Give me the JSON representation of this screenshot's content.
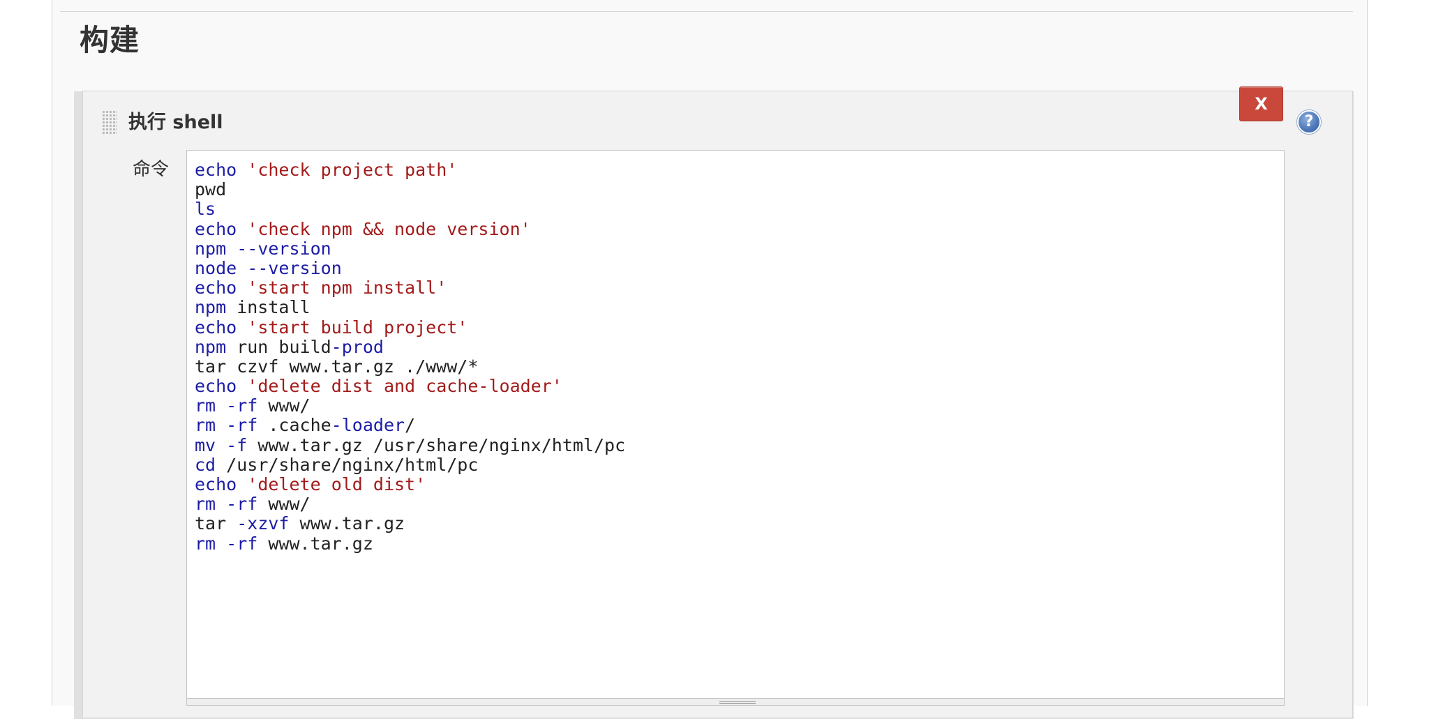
{
  "section": {
    "title": "构建"
  },
  "build_step": {
    "title": "执行 shell",
    "delete_label": "X",
    "help_label": "?",
    "command_label": "命令"
  },
  "command": {
    "lines": [
      [
        {
          "t": "echo",
          "c": "kw"
        },
        {
          "t": " ",
          "c": "plain"
        },
        {
          "t": "'check project path'",
          "c": "str"
        }
      ],
      [
        {
          "t": "pwd",
          "c": "plain"
        }
      ],
      [
        {
          "t": "ls",
          "c": "kw"
        }
      ],
      [
        {
          "t": "echo",
          "c": "kw"
        },
        {
          "t": " ",
          "c": "plain"
        },
        {
          "t": "'check npm && node version'",
          "c": "str"
        }
      ],
      [
        {
          "t": "npm",
          "c": "kw"
        },
        {
          "t": " ",
          "c": "plain"
        },
        {
          "t": "--version",
          "c": "kw"
        }
      ],
      [
        {
          "t": "node",
          "c": "kw"
        },
        {
          "t": " ",
          "c": "plain"
        },
        {
          "t": "--version",
          "c": "kw"
        }
      ],
      [
        {
          "t": "echo",
          "c": "kw"
        },
        {
          "t": " ",
          "c": "plain"
        },
        {
          "t": "'start npm install'",
          "c": "str"
        }
      ],
      [
        {
          "t": "npm",
          "c": "kw"
        },
        {
          "t": " install",
          "c": "plain"
        }
      ],
      [
        {
          "t": "echo",
          "c": "kw"
        },
        {
          "t": " ",
          "c": "plain"
        },
        {
          "t": "'start build project'",
          "c": "str"
        }
      ],
      [
        {
          "t": "npm",
          "c": "kw"
        },
        {
          "t": " run build",
          "c": "plain"
        },
        {
          "t": "-prod",
          "c": "kw"
        }
      ],
      [
        {
          "t": "tar czvf www.tar.gz ./www/*",
          "c": "plain"
        }
      ],
      [
        {
          "t": "echo",
          "c": "kw"
        },
        {
          "t": " ",
          "c": "plain"
        },
        {
          "t": "'delete dist and cache-loader'",
          "c": "str"
        }
      ],
      [
        {
          "t": "rm",
          "c": "kw"
        },
        {
          "t": " ",
          "c": "plain"
        },
        {
          "t": "-rf",
          "c": "kw"
        },
        {
          "t": " www/",
          "c": "plain"
        }
      ],
      [
        {
          "t": "rm",
          "c": "kw"
        },
        {
          "t": " ",
          "c": "plain"
        },
        {
          "t": "-rf",
          "c": "kw"
        },
        {
          "t": " .cache",
          "c": "plain"
        },
        {
          "t": "-loader",
          "c": "kw"
        },
        {
          "t": "/",
          "c": "plain"
        }
      ],
      [
        {
          "t": "mv",
          "c": "kw"
        },
        {
          "t": " ",
          "c": "plain"
        },
        {
          "t": "-f",
          "c": "kw"
        },
        {
          "t": " www.tar.gz /usr/share/nginx/html/pc",
          "c": "plain"
        }
      ],
      [
        {
          "t": "cd",
          "c": "kw"
        },
        {
          "t": " /usr/share/nginx/html/pc",
          "c": "plain"
        }
      ],
      [
        {
          "t": "echo",
          "c": "kw"
        },
        {
          "t": " ",
          "c": "plain"
        },
        {
          "t": "'delete old dist'",
          "c": "str"
        }
      ],
      [
        {
          "t": "rm",
          "c": "kw"
        },
        {
          "t": " ",
          "c": "plain"
        },
        {
          "t": "-rf",
          "c": "kw"
        },
        {
          "t": " www/",
          "c": "plain"
        }
      ],
      [
        {
          "t": "tar",
          "c": "plain"
        },
        {
          "t": " ",
          "c": "plain"
        },
        {
          "t": "-xzvf",
          "c": "kw"
        },
        {
          "t": " www.tar.gz",
          "c": "plain"
        }
      ],
      [
        {
          "t": "rm",
          "c": "kw"
        },
        {
          "t": " ",
          "c": "plain"
        },
        {
          "t": "-rf",
          "c": "kw"
        },
        {
          "t": " www.tar.gz",
          "c": "plain"
        }
      ]
    ]
  },
  "colors": {
    "keyword": "#1c1ca6",
    "string": "#a31a1a",
    "plain": "#222222",
    "delete_button": "#c9483b",
    "help_icon": "#4a76b8"
  },
  "icons": {
    "drag": "drag-handle-icon",
    "help": "help-icon"
  }
}
